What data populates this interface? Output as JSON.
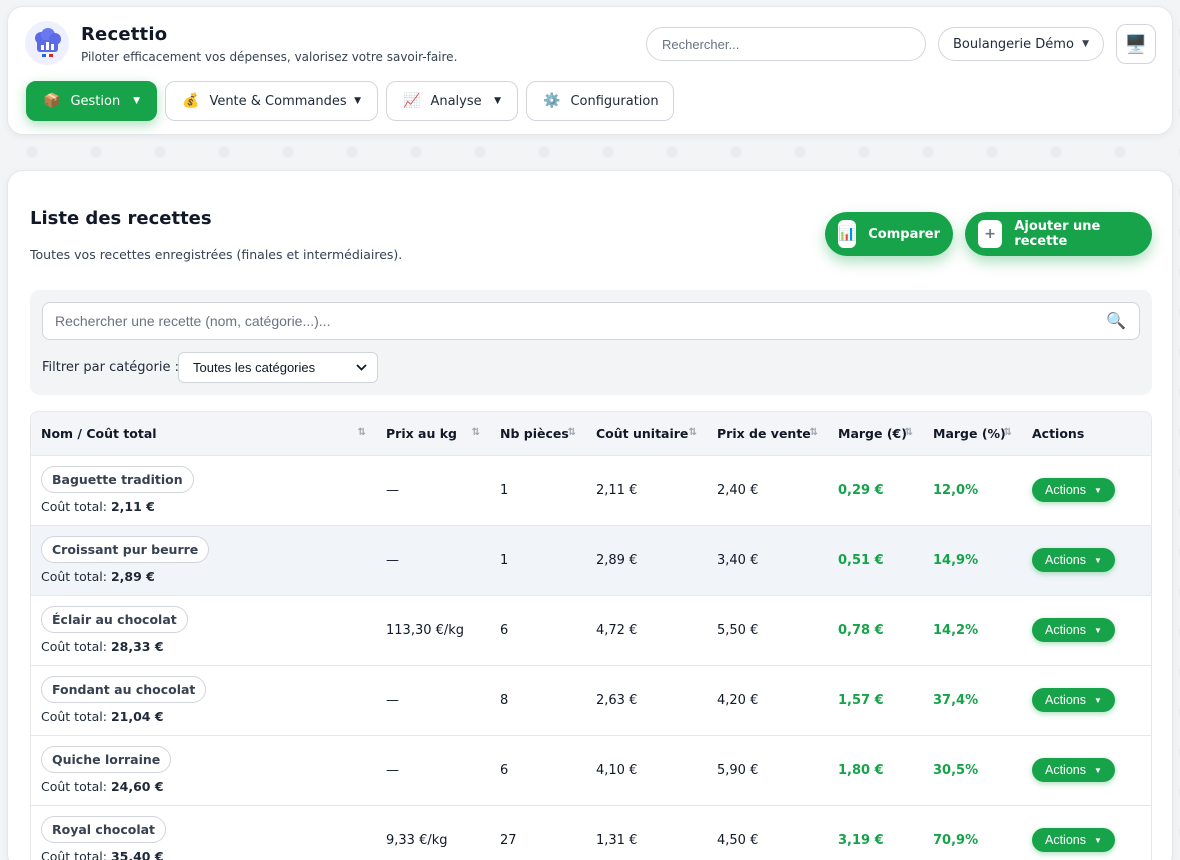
{
  "app": {
    "title": "Recettio",
    "tagline": "Piloter efficacement vos dépenses, valorisez votre savoir-faire."
  },
  "header": {
    "search_placeholder": "Rechercher...",
    "bakery_name": "Boulangerie Démo",
    "monitor_icon": "🖥️"
  },
  "nav": [
    {
      "label": "Gestion",
      "icon": "📦",
      "has_dropdown": true,
      "active": true
    },
    {
      "label": "Vente & Commandes",
      "icon": "💰",
      "has_dropdown": true,
      "active": false
    },
    {
      "label": "Analyse",
      "icon": "📈",
      "has_dropdown": true,
      "active": false
    },
    {
      "label": "Configuration",
      "icon": "⚙️",
      "has_dropdown": false,
      "active": false
    }
  ],
  "page": {
    "title": "Liste des recettes",
    "subtitle": "Toutes vos recettes enregistrées (finales et intermédiaires).",
    "compare_label": "Comparer",
    "add_label": "Ajouter une recette"
  },
  "filters": {
    "search_placeholder": "Rechercher une recette (nom, catégorie...)...",
    "category_label": "Filtrer par catégorie :",
    "category_selected": "Toutes les catégories"
  },
  "table": {
    "columns": [
      "Nom / Coût total",
      "Prix au kg",
      "Nb pièces",
      "Coût unitaire",
      "Prix de vente",
      "Marge (€)",
      "Marge (%)",
      "Actions"
    ],
    "cost_prefix": "Coût total:",
    "actions_label": "Actions",
    "rows": [
      {
        "name": "Baguette tradition",
        "total_cost": "2,11 €",
        "price_kg": "—",
        "pieces": "1",
        "unit_cost": "2,11 €",
        "sale_price": "2,40 €",
        "margin_eur": "0,29 €",
        "margin_pct": "12,0%"
      },
      {
        "name": "Croissant pur beurre",
        "total_cost": "2,89 €",
        "price_kg": "—",
        "pieces": "1",
        "unit_cost": "2,89 €",
        "sale_price": "3,40 €",
        "margin_eur": "0,51 €",
        "margin_pct": "14,9%"
      },
      {
        "name": "Éclair au chocolat",
        "total_cost": "28,33 €",
        "price_kg": "113,30 €/kg",
        "pieces": "6",
        "unit_cost": "4,72 €",
        "sale_price": "5,50 €",
        "margin_eur": "0,78 €",
        "margin_pct": "14,2%"
      },
      {
        "name": "Fondant au chocolat",
        "total_cost": "21,04 €",
        "price_kg": "—",
        "pieces": "8",
        "unit_cost": "2,63 €",
        "sale_price": "4,20 €",
        "margin_eur": "1,57 €",
        "margin_pct": "37,4%"
      },
      {
        "name": "Quiche lorraine",
        "total_cost": "24,60 €",
        "price_kg": "—",
        "pieces": "6",
        "unit_cost": "4,10 €",
        "sale_price": "5,90 €",
        "margin_eur": "1,80 €",
        "margin_pct": "30,5%"
      },
      {
        "name": "Royal chocolat",
        "total_cost": "35,40 €",
        "price_kg": "9,33 €/kg",
        "pieces": "27",
        "unit_cost": "1,31 €",
        "sale_price": "4,50 €",
        "margin_eur": "3,19 €",
        "margin_pct": "70,9%"
      }
    ]
  },
  "colors": {
    "accent": "#16a34a",
    "positive": "#16a34a"
  }
}
